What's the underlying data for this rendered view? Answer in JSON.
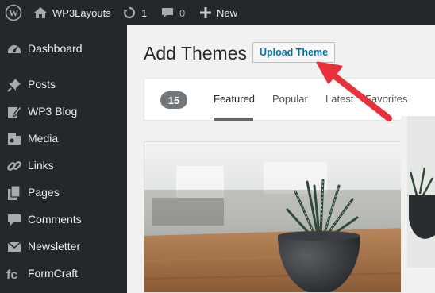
{
  "adminbar": {
    "site_name": "WP3Layouts",
    "updates_count": "1",
    "comments_count": "0",
    "new_label": "New",
    "icons": [
      "wordpress-icon",
      "home-icon",
      "updates-icon",
      "comment-icon",
      "plus-icon"
    ]
  },
  "sidebar": {
    "items": [
      {
        "label": "Dashboard",
        "icon": "dashboard-icon"
      },
      {
        "label": "Posts",
        "icon": "pin-icon"
      },
      {
        "label": "WP3 Blog",
        "icon": "edit-icon"
      },
      {
        "label": "Media",
        "icon": "media-icon"
      },
      {
        "label": "Links",
        "icon": "link-icon"
      },
      {
        "label": "Pages",
        "icon": "pages-icon"
      },
      {
        "label": "Comments",
        "icon": "comment-icon"
      },
      {
        "label": "Newsletter",
        "icon": "mail-icon"
      },
      {
        "label": "FormCraft",
        "icon": "formcraft-icon"
      }
    ]
  },
  "main": {
    "title": "Add Themes",
    "upload_button": "Upload Theme",
    "theme_count": "15",
    "tabs": [
      "Featured",
      "Popular",
      "Latest",
      "Favorites"
    ],
    "active_tab": "Featured"
  },
  "colors": {
    "adminbar_bg": "#23282d",
    "link_blue": "#0073aa",
    "annotation_red": "#e8313a"
  }
}
